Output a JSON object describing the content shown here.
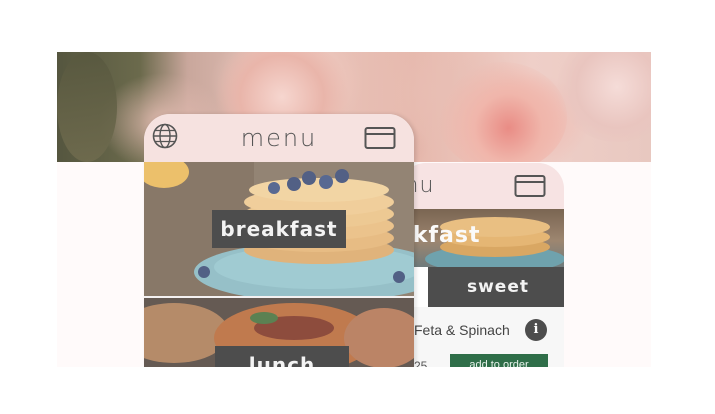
{
  "front_screen": {
    "title": "menu",
    "categories": [
      {
        "label": "breakfast"
      },
      {
        "label": "lunch"
      }
    ]
  },
  "back_screen": {
    "title_partial": "enu",
    "hero_label_partial": "akfast",
    "tab_label": "sweet",
    "item_name_partial": "Feta & Spinach",
    "info_label": "i",
    "price_partial": "25",
    "add_button_label": "add to order"
  },
  "icons": {
    "language": "globe-icon",
    "payment": "credit-card-icon"
  },
  "colors": {
    "label_background": "#4d4d4d",
    "top_bar_pink": "#f6dedc",
    "add_button_green": "#2f6e49"
  }
}
